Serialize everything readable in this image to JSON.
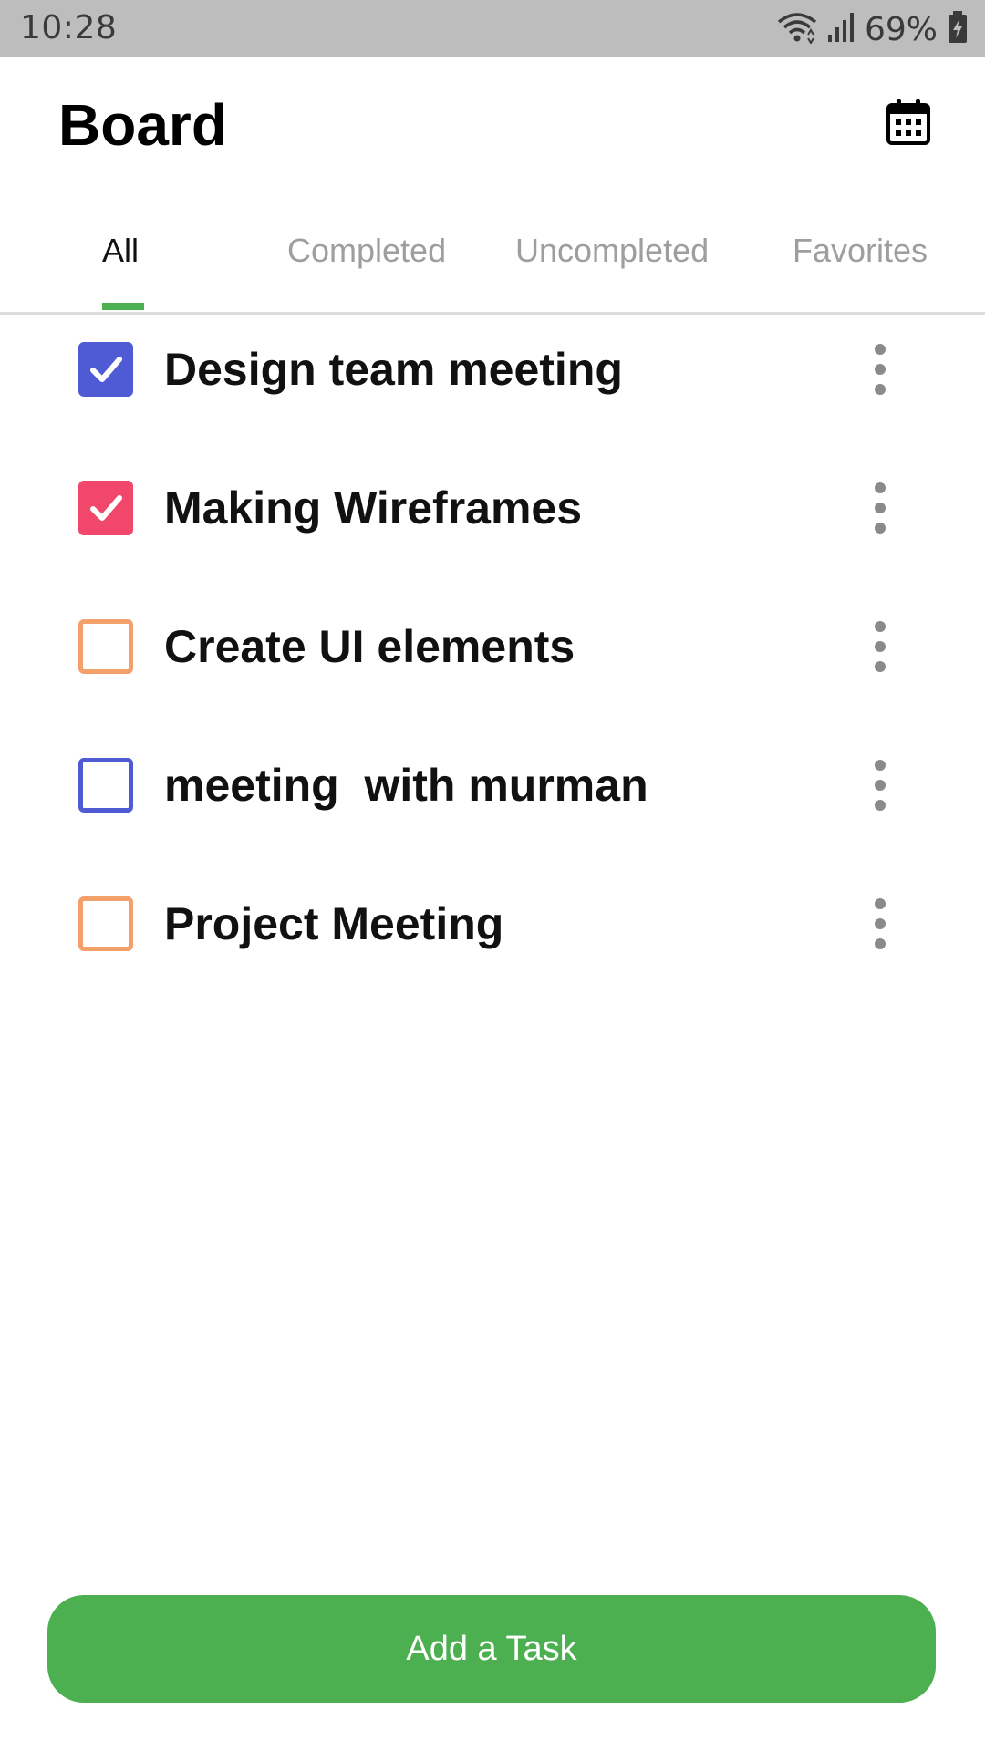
{
  "status_bar": {
    "time": "10:28",
    "battery_percent": "69%",
    "icons": [
      "wifi-icon",
      "signal-icon",
      "battery-charging-icon"
    ]
  },
  "header": {
    "title": "Board",
    "calendar_icon": "calendar-icon"
  },
  "tabs": [
    {
      "label": "All",
      "active": true
    },
    {
      "label": "Completed",
      "active": false
    },
    {
      "label": "Uncompleted",
      "active": false
    },
    {
      "label": "Favorites",
      "active": false
    }
  ],
  "tasks": [
    {
      "title": "Design team meeting",
      "checked": true,
      "color": "#4f5bd5"
    },
    {
      "title": "Making Wireframes",
      "checked": true,
      "color": "#f0476b"
    },
    {
      "title": "Create UI elements",
      "checked": false,
      "color": "#f4a06b"
    },
    {
      "title": "meeting  with murman",
      "checked": false,
      "color": "#4f5bd5"
    },
    {
      "title": "Project Meeting",
      "checked": false,
      "color": "#f4a06b"
    }
  ],
  "add_button": {
    "label": "Add a Task"
  },
  "colors": {
    "accent": "#4caf50",
    "status_bar_bg": "#bdbdbd"
  }
}
